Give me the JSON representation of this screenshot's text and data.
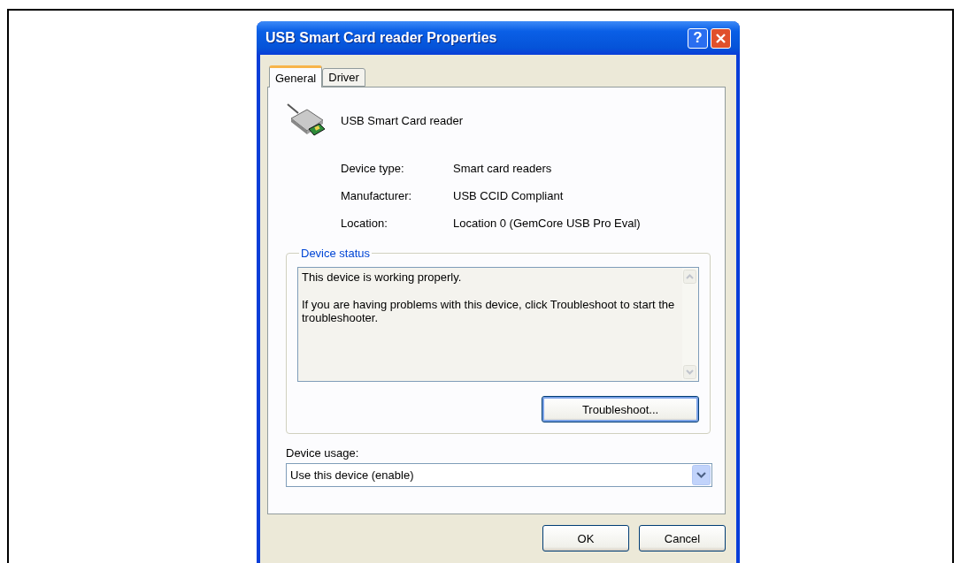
{
  "window": {
    "title": "USB Smart Card reader Properties",
    "help_label": "?"
  },
  "tabs": [
    {
      "label": "General",
      "selected": true
    },
    {
      "label": "Driver",
      "selected": false
    }
  ],
  "device": {
    "name": "USB Smart Card reader"
  },
  "properties": [
    {
      "label": "Device type:",
      "value": "Smart card readers"
    },
    {
      "label": "Manufacturer:",
      "value": "USB CCID Compliant"
    },
    {
      "label": "Location:",
      "value": "Location 0 (GemCore USB Pro Eval)"
    }
  ],
  "device_status": {
    "title": "Device status",
    "paragraphs": [
      "This device is working properly.",
      "If you are having problems with this device, click Troubleshoot to start the troubleshooter."
    ],
    "button": "Troubleshoot..."
  },
  "device_usage": {
    "label": "Device usage:",
    "value": "Use this device (enable)"
  },
  "buttons": [
    {
      "label": "OK",
      "default": false
    },
    {
      "label": "Cancel",
      "default": false
    }
  ]
}
